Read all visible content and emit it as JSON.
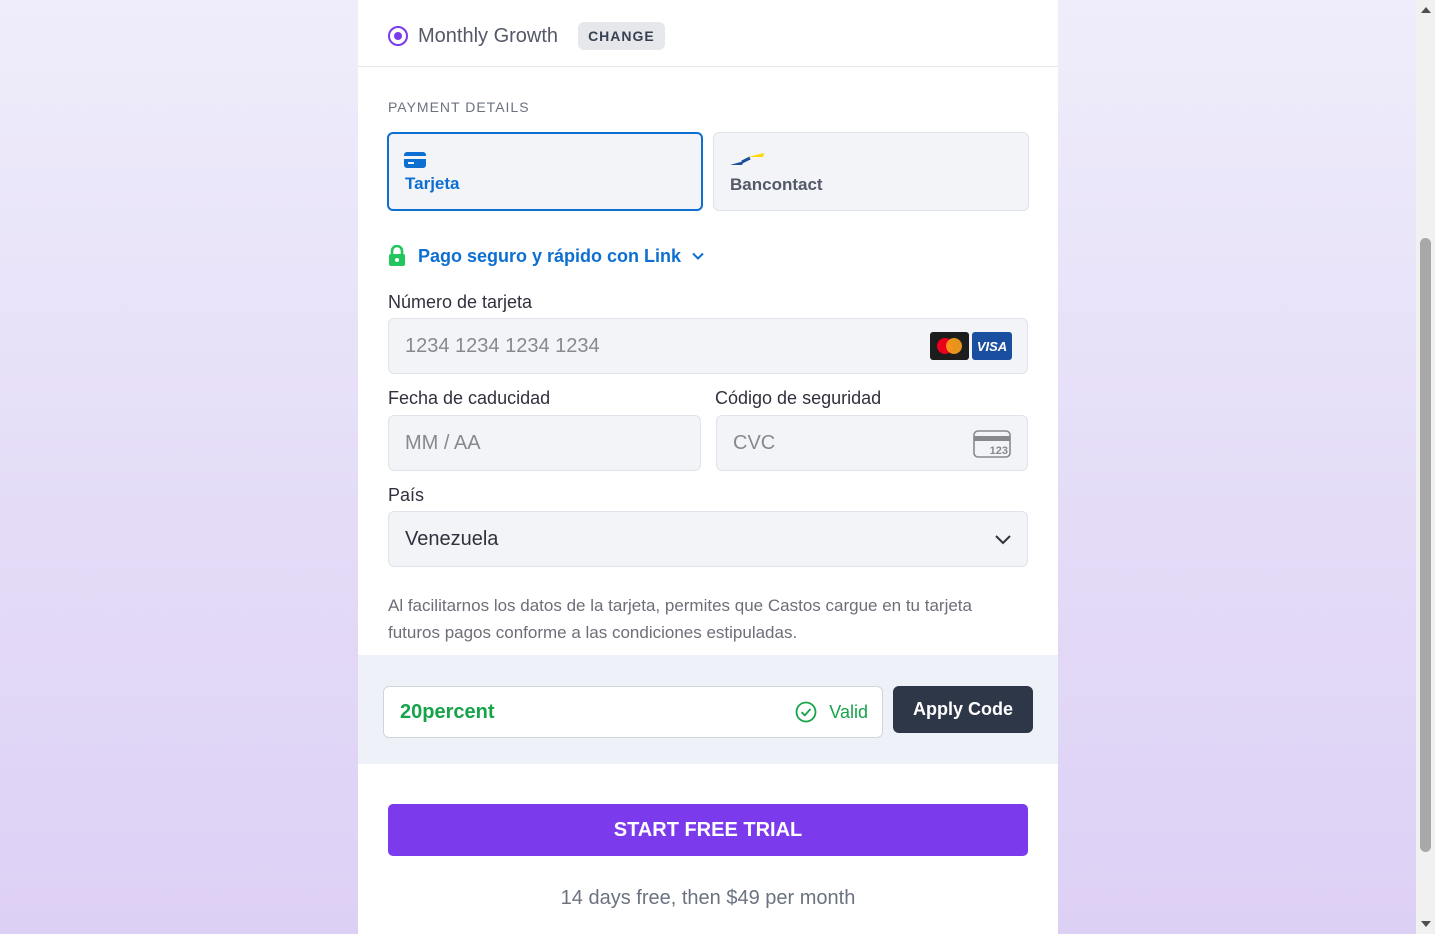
{
  "plan": {
    "name": "Monthly Growth",
    "change_label": "CHANGE"
  },
  "payment": {
    "section_label": "PAYMENT DETAILS",
    "methods": [
      {
        "label": "Tarjeta",
        "icon": "credit-card-icon",
        "selected": true
      },
      {
        "label": "Bancontact",
        "icon": "bancontact-icon",
        "selected": false
      }
    ],
    "link_text": "Pago seguro y rápido con Link",
    "card_number": {
      "label": "Número de tarjeta",
      "placeholder": "1234 1234 1234 1234",
      "brands": [
        "Mastercard",
        "VISA"
      ]
    },
    "expiry": {
      "label": "Fecha de caducidad",
      "placeholder": "MM / AA"
    },
    "cvc": {
      "label": "Código de seguridad",
      "placeholder": "CVC",
      "icon_text": "123"
    },
    "country": {
      "label": "País",
      "value": "Venezuela"
    },
    "legal_text": "Al facilitarnos los datos de la tarjeta, permites que Castos cargue en tu tarjeta futuros pagos conforme a las condiciones estipuladas."
  },
  "promo": {
    "code": "20percent",
    "status": "Valid",
    "apply_label": "Apply Code"
  },
  "cta": {
    "label": "START FREE TRIAL",
    "note": "14 days free, then $49 per month"
  },
  "colors": {
    "accent": "#7c3aed",
    "link_blue": "#0d6fd1",
    "valid_green": "#16a34a",
    "dark_button": "#2d3748"
  }
}
